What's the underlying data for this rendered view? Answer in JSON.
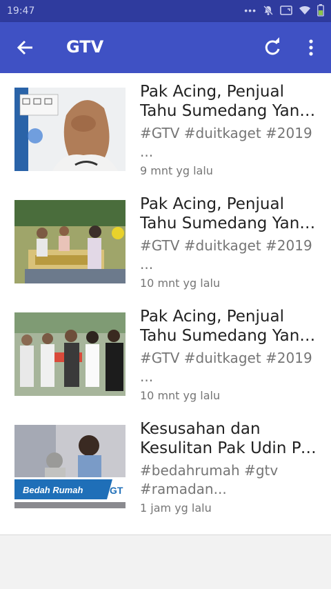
{
  "status_bar": {
    "time": "19:47",
    "icons": [
      "more-dots",
      "bell-off-icon",
      "screen-icon",
      "wifi-icon",
      "battery-icon"
    ]
  },
  "app_bar": {
    "title": "GTV",
    "accent": "#3f51c4"
  },
  "videos": [
    {
      "title_line1": "Pak Acing, Penjual",
      "title_line2": "Tahu Sumedang Yang...",
      "desc_line1": "#GTV #duitkaget #2019",
      "desc_line2": "...",
      "time": "9 mnt yg lalu"
    },
    {
      "title_line1": "Pak Acing, Penjual",
      "title_line2": "Tahu Sumedang Yang...",
      "desc_line1": "#GTV #duitkaget #2019",
      "desc_line2": "...",
      "time": "10 mnt yg lalu"
    },
    {
      "title_line1": "Pak Acing, Penjual",
      "title_line2": "Tahu Sumedang Yang...",
      "desc_line1": "#GTV #duitkaget #2019",
      "desc_line2": "...",
      "time": "10 mnt yg lalu"
    },
    {
      "title_line1": "Kesusahan dan",
      "title_line2": "Kesulitan Pak Udin Pe...",
      "desc_line1": "#bedahrumah #gtv",
      "desc_line2": "#ramadan...",
      "time": "1 jam yg lalu",
      "thumb_banner": "Bedah Rumah",
      "thumb_logo": "GT"
    }
  ]
}
